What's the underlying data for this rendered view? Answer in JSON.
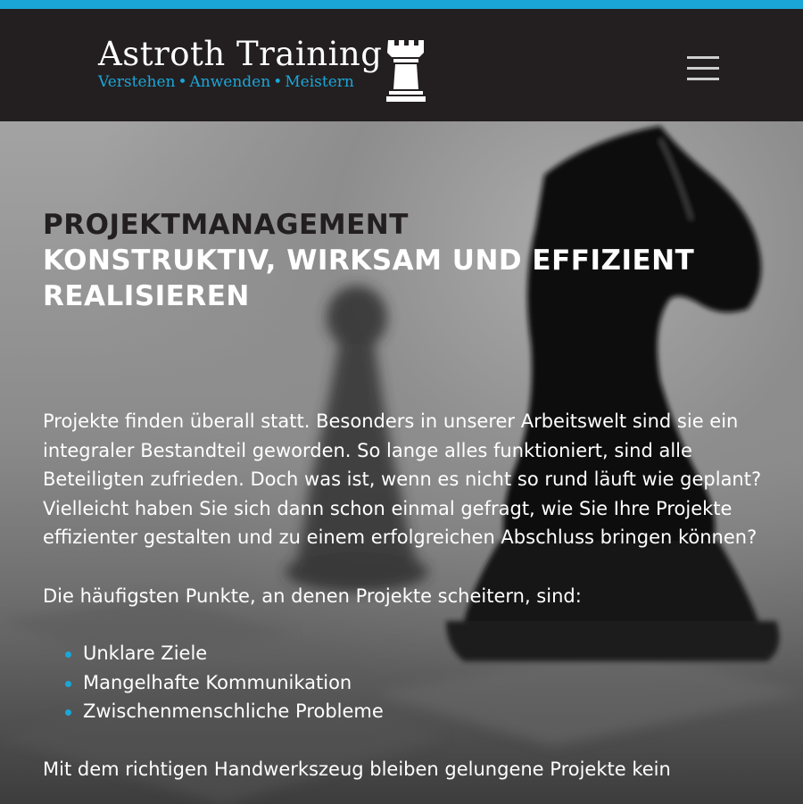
{
  "brand": {
    "name": "Astroth Training",
    "tagline": [
      "Verstehen",
      "Anwenden",
      "Meistern"
    ]
  },
  "icons": {
    "logo": "rook-icon",
    "menu": "hamburger-menu-icon"
  },
  "colors": {
    "accent": "#1ba6d8",
    "header_bg": "#231f20",
    "heading_dark": "#231f20"
  },
  "hero": {
    "heading_line1": "PROJEKTMANAGEMENT",
    "heading_line2": "KONSTRUKTIV, WIRKSAM UND EFFIZIENT",
    "heading_line3": "REALISIEREN",
    "intro": "Projekte finden überall statt. Besonders in unserer Arbeitswelt sind sie ein integraler Bestandteil geworden. So lange alles funktioniert, sind alle Beteiligten zufrieden. Doch was ist, wenn es nicht so rund läuft wie geplant? Vielleicht haben Sie sich dann schon einmal gefragt, wie Sie Ihre Projekte effizienter gestalten und zu einem erfolgreichen Abschluss bringen können?",
    "points_intro": "Die häufigsten Punkte, an denen Projekte scheitern, sind:",
    "points": [
      "Unklare Ziele",
      "Mangelhafte Kommunikation",
      "Zwischenmenschliche Probleme"
    ],
    "closing": "Mit dem richtigen Handwerkszeug bleiben gelungene Projekte kein"
  }
}
